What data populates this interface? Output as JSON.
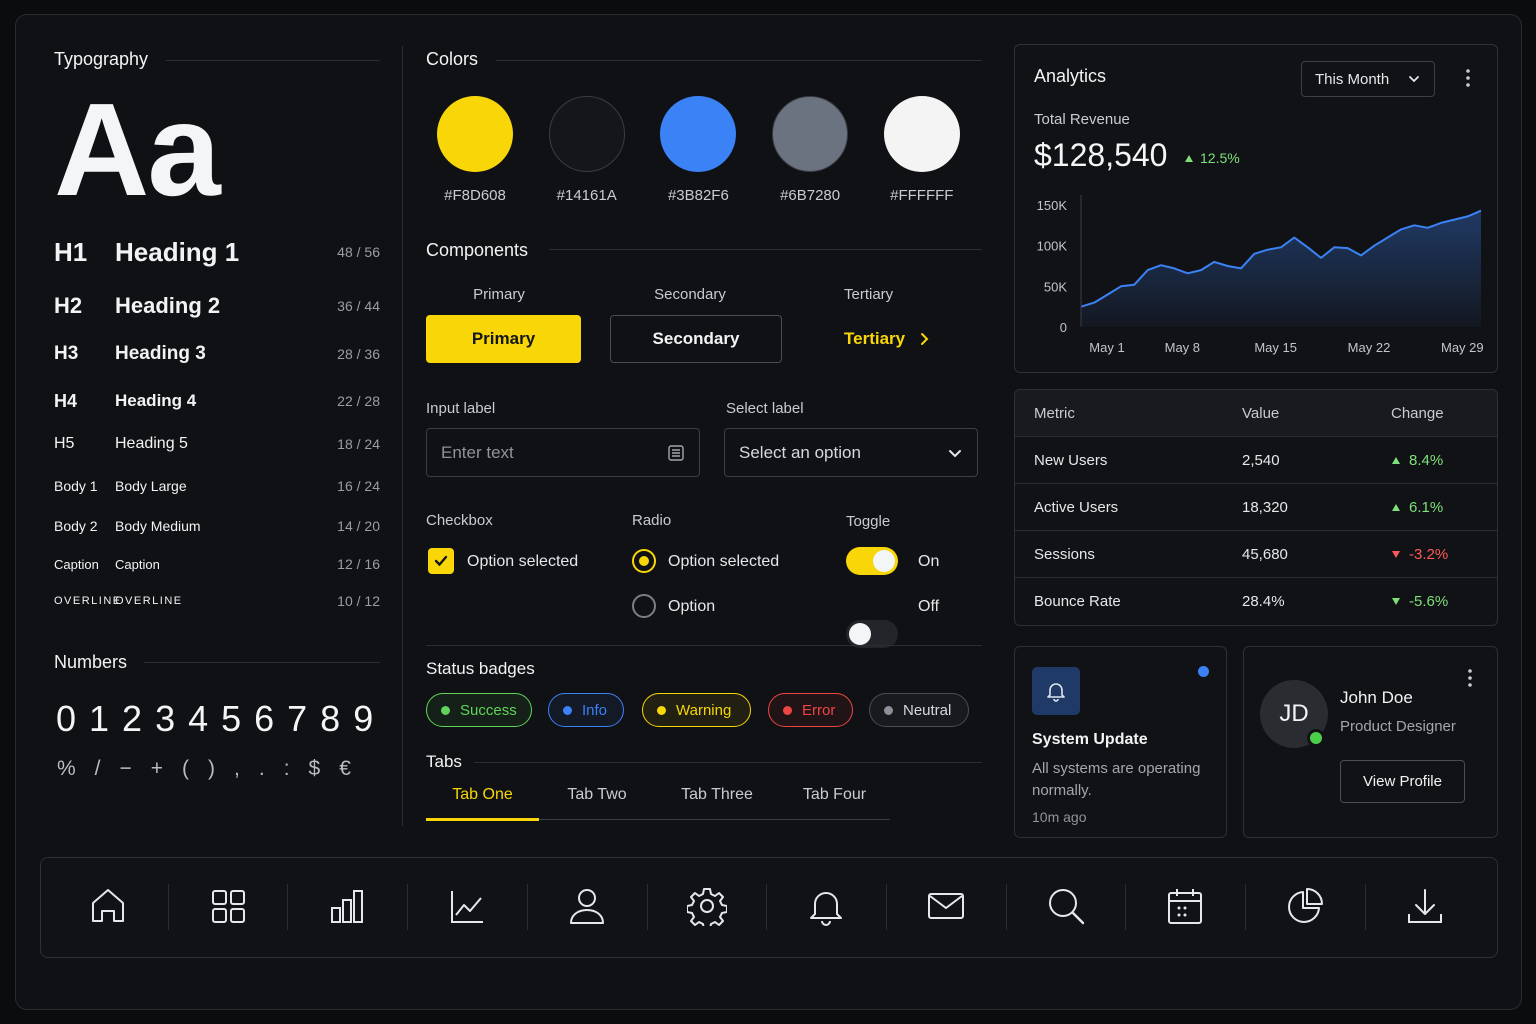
{
  "typography": {
    "title": "Typography",
    "specimen": "Aa",
    "rows": [
      {
        "tag": "H1",
        "name": "Heading 1",
        "size": "48 / 56"
      },
      {
        "tag": "H2",
        "name": "Heading 2",
        "size": "36 / 44"
      },
      {
        "tag": "H3",
        "name": "Heading 3",
        "size": "28 / 36"
      },
      {
        "tag": "H4",
        "name": "Heading 4",
        "size": "22 / 28"
      },
      {
        "tag": "H5",
        "name": "Heading 5",
        "size": "18 / 24"
      },
      {
        "tag": "Body 1",
        "name": "Body Large",
        "size": "16 / 24"
      },
      {
        "tag": "Body 2",
        "name": "Body Medium",
        "size": "14 / 20"
      },
      {
        "tag": "Caption",
        "name": "Caption",
        "size": "12 / 16"
      },
      {
        "tag": "OVERLINE",
        "name": "OVERLINE",
        "size": "10 / 12"
      }
    ],
    "numbers_title": "Numbers",
    "digits": "0123456789",
    "symbols": "%/−+(),.:$€"
  },
  "colors": {
    "title": "Colors",
    "swatches": [
      {
        "hex": "#F8D608",
        "fill": "#f8d608"
      },
      {
        "hex": "#14161A",
        "fill": "#14161a"
      },
      {
        "hex": "#3B82F6",
        "fill": "#3b82f6"
      },
      {
        "hex": "#6B7280",
        "fill": "#6b7280"
      },
      {
        "hex": "#FFFFFF",
        "fill": "#f4f4f4"
      }
    ]
  },
  "components": {
    "title": "Components",
    "buttons": {
      "primary_caption": "Primary",
      "primary_label": "Primary",
      "secondary_caption": "Secondary",
      "secondary_label": "Secondary",
      "tertiary_caption": "Tertiary",
      "tertiary_label": "Tertiary"
    },
    "input": {
      "label": "Input label",
      "placeholder": "Enter text"
    },
    "select": {
      "label": "Select label",
      "value": "Select an option"
    },
    "checkbox": {
      "label": "Checkbox",
      "option": "Option selected",
      "checked": true
    },
    "radio": {
      "label": "Radio",
      "options": [
        "Option selected",
        "Option"
      ],
      "selected_index": 0
    },
    "toggle": {
      "label": "Toggle",
      "on_label": "On",
      "off_label": "Off"
    }
  },
  "status_badges": {
    "title": "Status badges",
    "items": [
      {
        "label": "Success",
        "color": "#5fd35a"
      },
      {
        "label": "Info",
        "color": "#3b82f6"
      },
      {
        "label": "Warning",
        "color": "#f8d608"
      },
      {
        "label": "Error",
        "color": "#ef4444"
      },
      {
        "label": "Neutral",
        "color": "#8b8f97"
      }
    ]
  },
  "tabs": {
    "title": "Tabs",
    "items": [
      "Tab One",
      "Tab Two",
      "Tab Three",
      "Tab Four"
    ],
    "active_index": 0
  },
  "analytics": {
    "title": "Analytics",
    "period": "This Month",
    "metric_label": "Total Revenue",
    "metric_value": "$128,540",
    "metric_change": "12.5%",
    "chart_data": {
      "type": "area",
      "title": "",
      "xlabel": "",
      "ylabel": "",
      "x_tick_labels": [
        "May 1",
        "May 8",
        "May 15",
        "May 22",
        "May 29"
      ],
      "y_tick_labels": [
        "0",
        "50K",
        "100K",
        "150K"
      ],
      "ylim": [
        0,
        150000
      ],
      "xlim": [
        1,
        31
      ],
      "x": [
        1,
        2,
        3,
        4,
        5,
        6,
        7,
        8,
        9,
        10,
        11,
        12,
        13,
        14,
        15,
        16,
        17,
        18,
        19,
        20,
        21,
        22,
        23,
        24,
        25,
        26,
        27,
        28,
        29,
        30,
        31
      ],
      "values": [
        25000,
        30000,
        40000,
        50000,
        52000,
        70000,
        76000,
        72000,
        66000,
        70000,
        80000,
        75000,
        72000,
        90000,
        95000,
        98000,
        110000,
        98000,
        85000,
        98000,
        97000,
        88000,
        100000,
        110000,
        120000,
        125000,
        122000,
        128000,
        132000,
        136000,
        143000
      ],
      "color": "#3b82f6",
      "grid": false
    }
  },
  "metrics_table": {
    "headers": [
      "Metric",
      "Value",
      "Change"
    ],
    "rows": [
      {
        "metric": "New Users",
        "value": "2,540",
        "change": "8.4%",
        "dir": "up"
      },
      {
        "metric": "Active Users",
        "value": "18,320",
        "change": "6.1%",
        "dir": "up"
      },
      {
        "metric": "Sessions",
        "value": "45,680",
        "change": "-3.2%",
        "dir": "down"
      },
      {
        "metric": "Bounce Rate",
        "value": "28.4%",
        "change": "-5.6%",
        "dir": "up"
      }
    ]
  },
  "notification": {
    "title": "System Update",
    "body": "All systems are operating normally.",
    "time": "10m ago",
    "icon": "bell-icon"
  },
  "profile": {
    "initials": "JD",
    "name": "John Doe",
    "role": "Product Designer",
    "button": "View Profile",
    "online": true
  },
  "icon_bar": [
    "home-icon",
    "grid-icon",
    "bar-chart-icon",
    "line-chart-icon",
    "user-icon",
    "settings-icon",
    "bell-icon",
    "mail-icon",
    "search-icon",
    "calendar-icon",
    "pie-chart-icon",
    "download-icon"
  ]
}
